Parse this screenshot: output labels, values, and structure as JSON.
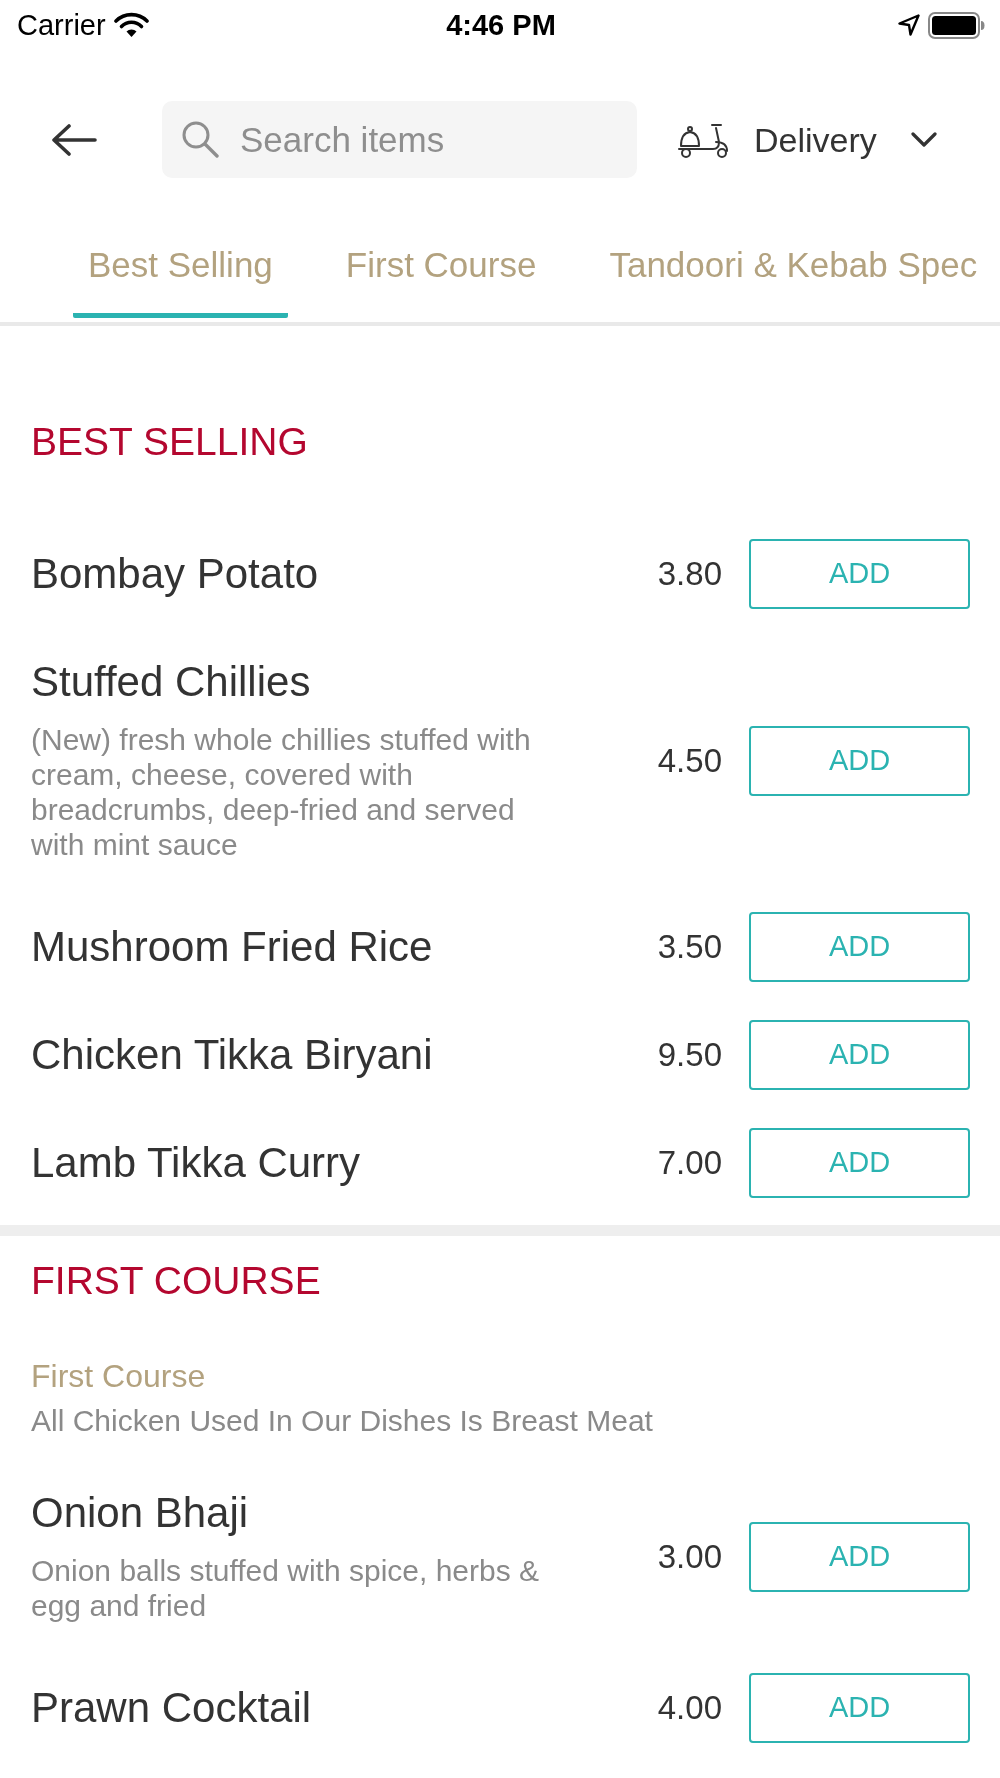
{
  "status_bar": {
    "carrier": "Carrier",
    "time": "4:46 PM"
  },
  "header": {
    "search": {
      "placeholder": "Search items"
    },
    "order_mode": {
      "label": "Delivery"
    }
  },
  "tabs": [
    {
      "label": "Best Selling",
      "selected": true
    },
    {
      "label": "First Course",
      "selected": false
    },
    {
      "label": "Tandoori & Kebab Spec",
      "selected": false
    }
  ],
  "sections": [
    {
      "title": "BEST SELLING",
      "items": [
        {
          "name": "Bombay Potato",
          "price": "3.80",
          "button": "ADD"
        },
        {
          "name": "Stuffed Chillies",
          "description": "(New) fresh whole chillies stuffed with cream, cheese, covered with breadcrumbs, deep-fried and served with mint sauce",
          "price": "4.50",
          "button": "ADD"
        },
        {
          "name": "Mushroom Fried Rice",
          "price": "3.50",
          "button": "ADD"
        },
        {
          "name": "Chicken Tikka Biryani",
          "price": "9.50",
          "button": "ADD"
        },
        {
          "name": "Lamb Tikka Curry",
          "price": "7.00",
          "button": "ADD"
        }
      ]
    },
    {
      "title": "FIRST COURSE",
      "subheading": "First Course",
      "note": "All Chicken Used In Our Dishes Is Breast Meat",
      "items": [
        {
          "name": "Onion Bhaji",
          "description": "Onion balls stuffed with spice, herbs & egg and fried",
          "price": "3.00",
          "button": "ADD"
        },
        {
          "name": "Prawn Cocktail",
          "price": "4.00",
          "button": "ADD"
        }
      ]
    }
  ]
}
